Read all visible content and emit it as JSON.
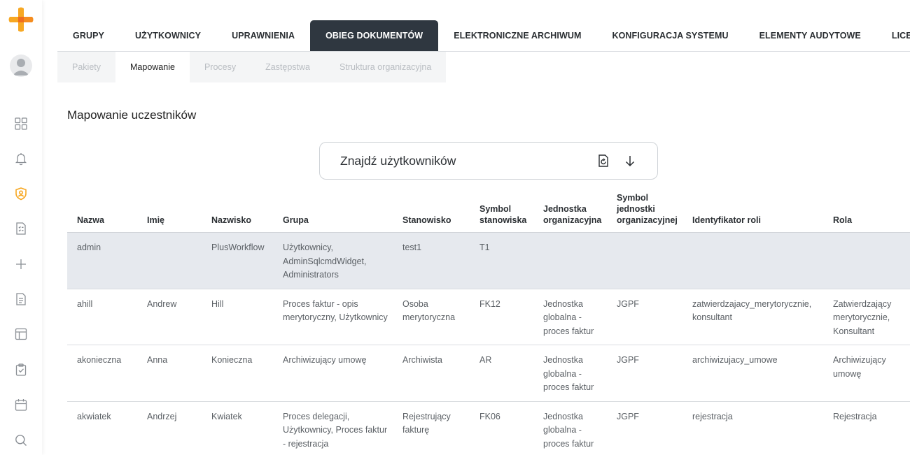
{
  "tabs": [
    {
      "label": "GRUPY",
      "active": false
    },
    {
      "label": "UŻYTKOWNICY",
      "active": false
    },
    {
      "label": "UPRAWNIENIA",
      "active": false
    },
    {
      "label": "OBIEG DOKUMENTÓW",
      "active": true
    },
    {
      "label": "ELEKTRONICZNE ARCHIWUM",
      "active": false
    },
    {
      "label": "KONFIGURACJA SYSTEMU",
      "active": false
    },
    {
      "label": "ELEMENTY AUDYTOWE",
      "active": false
    },
    {
      "label": "LICENCJA",
      "active": false
    }
  ],
  "subtabs": [
    {
      "label": "Pakiety",
      "active": false
    },
    {
      "label": "Mapowanie",
      "active": true
    },
    {
      "label": "Procesy",
      "active": false
    },
    {
      "label": "Zastępstwa",
      "active": false
    },
    {
      "label": "Struktura organizacyjna",
      "active": false
    }
  ],
  "page_title": "Mapowanie uczestników",
  "search": {
    "label": "Znajdź użytkowników"
  },
  "sidebar": {
    "icons": [
      "dashboard-icon",
      "bell-icon",
      "shield-user-icon",
      "checklist-icon",
      "plus-icon",
      "document-icon",
      "layout-icon",
      "clipboard-check-icon",
      "calendar-icon",
      "search-icon"
    ]
  },
  "colors": {
    "accent": "#f7a823",
    "active_tab": "#2f3740",
    "selected_row": "#e6e9ee"
  },
  "table": {
    "headers": [
      "Nazwa",
      "Imię",
      "Nazwisko",
      "Grupa",
      "Stanowisko",
      "Symbol stanowiska",
      "Jednostka organizacyjna",
      "Symbol jednostki organizacyjnej",
      "Identyfikator roli",
      "Rola"
    ],
    "rows": [
      {
        "selected": true,
        "cells": [
          "admin",
          "",
          "PlusWorkflow",
          "Użytkownicy, AdminSqlcmdWidget, Administrators",
          "test1",
          "T1",
          "",
          "",
          "",
          ""
        ]
      },
      {
        "selected": false,
        "cells": [
          "ahill",
          "Andrew",
          "Hill",
          "Proces faktur - opis merytoryczny, Użytkownicy",
          "Osoba merytoryczna",
          "FK12",
          "Jednostka globalna - proces faktur",
          "JGPF",
          "zatwierdzajacy_merytorycznie, konsultant",
          "Zatwierdzający merytorycznie, Konsultant"
        ]
      },
      {
        "selected": false,
        "cells": [
          "akonieczna",
          "Anna",
          "Konieczna",
          "Archiwizujący umowę",
          "Archiwista",
          "AR",
          "Jednostka globalna - proces faktur",
          "JGPF",
          "archiwizujacy_umowe",
          "Archiwizujący umowę"
        ]
      },
      {
        "selected": false,
        "cells": [
          "akwiatek",
          "Andrzej",
          "Kwiatek",
          "Proces delegacji, Użytkownicy, Proces faktur - rejestracja",
          "Rejestrujący fakturę",
          "FK06",
          "Jednostka globalna - proces faktur",
          "JGPF",
          "rejestracja",
          "Rejestracja"
        ]
      }
    ]
  }
}
